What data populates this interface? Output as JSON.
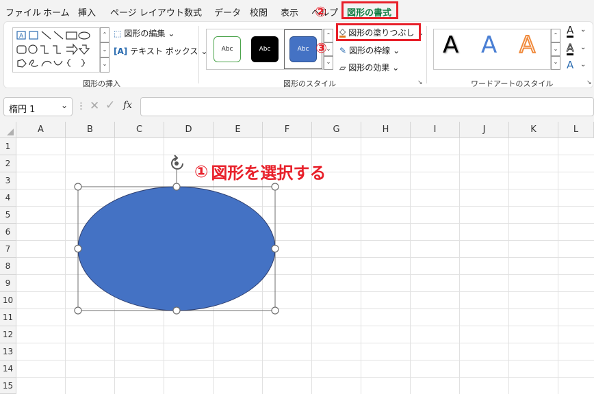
{
  "menu": {
    "items": [
      "ファイル",
      "ホーム",
      "挿入",
      "ページ レイアウト",
      "数式",
      "データ",
      "校閲",
      "表示",
      "ヘルプ"
    ],
    "active_tab": "図形の書式"
  },
  "ribbon": {
    "insert_shapes": {
      "label": "図形の挿入",
      "edit_shape": "図形の編集",
      "text_box": "テキスト ボックス"
    },
    "shape_styles": {
      "label": "図形のスタイル",
      "thumbs": [
        "Abc",
        "Abc",
        "Abc"
      ],
      "fill": "図形の塗りつぶし",
      "outline": "図形の枠線",
      "effects": "図形の効果"
    },
    "wordart_styles": {
      "label": "ワードアートのスタイル",
      "letters": [
        "A",
        "A",
        "A"
      ]
    }
  },
  "formula_bar": {
    "name_box": "楕円 1",
    "fx": "fx",
    "formula": ""
  },
  "sheet": {
    "columns": [
      "A",
      "B",
      "C",
      "D",
      "E",
      "F",
      "G",
      "H",
      "I",
      "J",
      "K",
      "L"
    ],
    "rows": [
      "1",
      "2",
      "3",
      "4",
      "5",
      "6",
      "7",
      "8",
      "9",
      "10",
      "11",
      "12",
      "13",
      "14",
      "15"
    ]
  },
  "annotations": {
    "step1_num": "①",
    "step1_text": "図形を選択する",
    "step2_num": "②",
    "step3_num": "③",
    "color": "#e8202a"
  },
  "colors": {
    "ellipse_fill": "#4472c4",
    "accent": "#107c41"
  }
}
